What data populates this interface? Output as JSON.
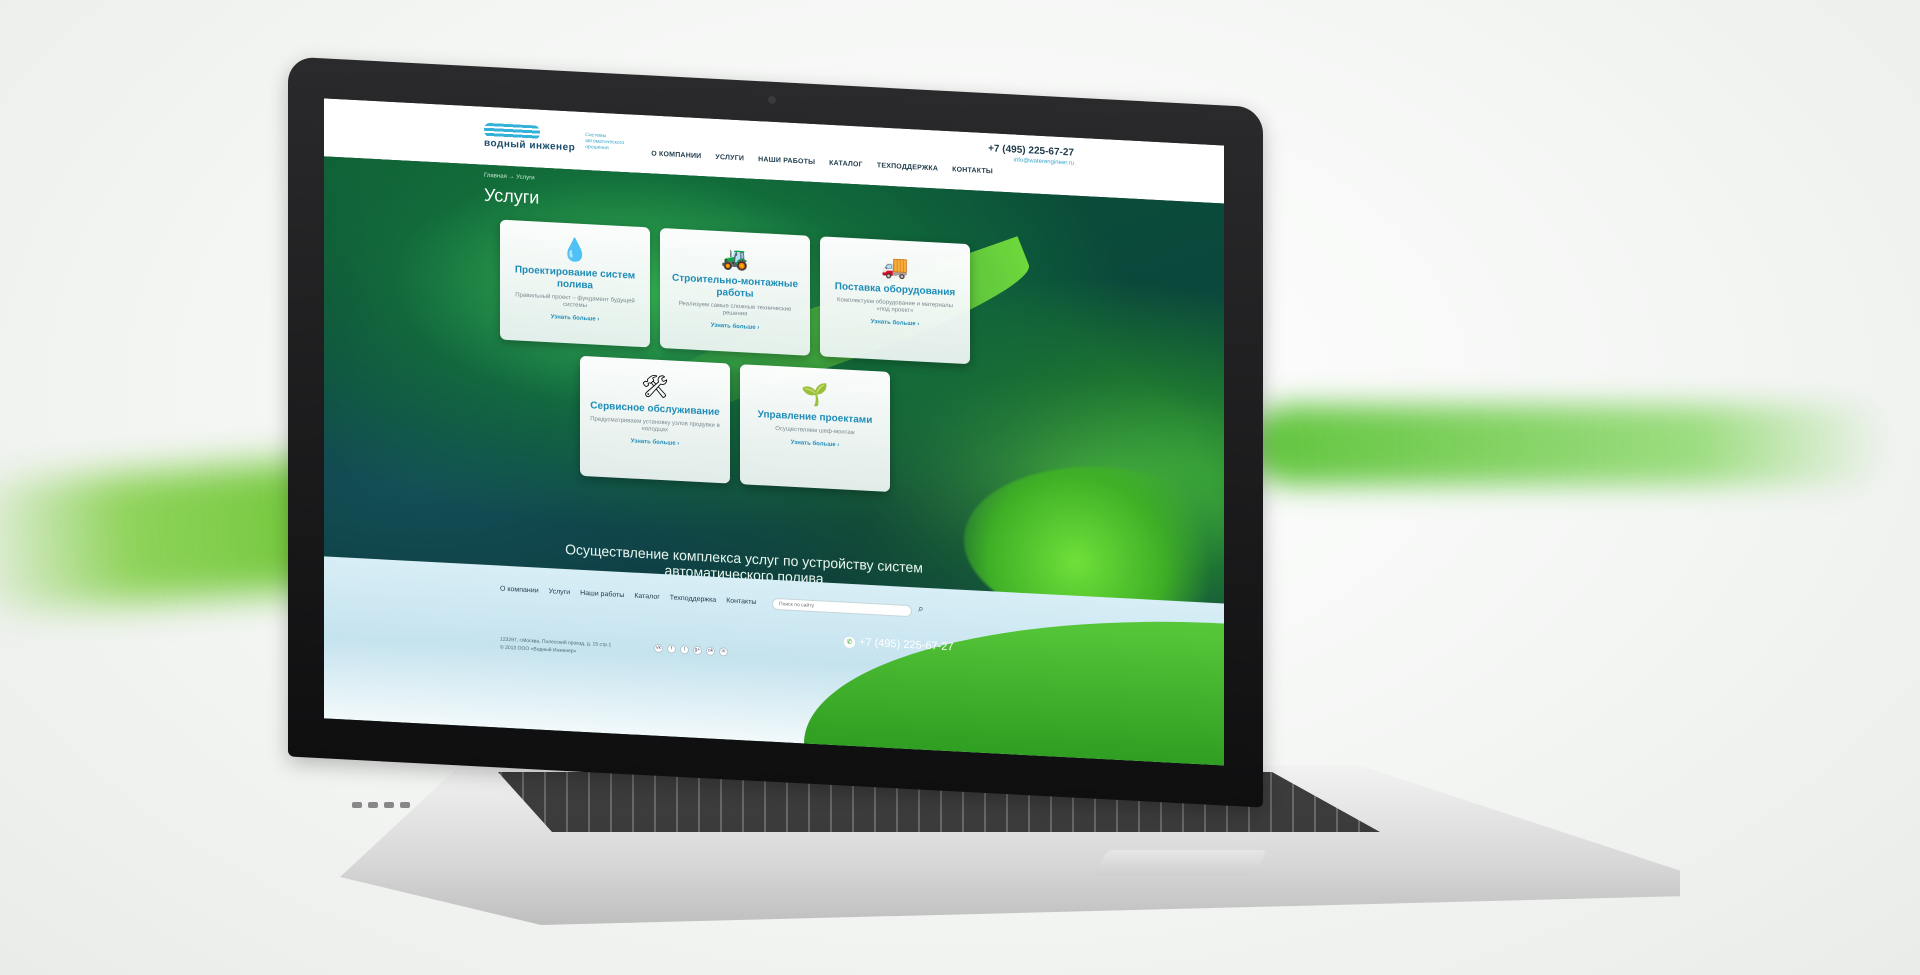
{
  "header": {
    "logo_name": "водный инженер",
    "logo_tagline": "Системы автоматического орошения",
    "phone": "+7 (495) 225-67-27",
    "email": "info@waterengineer.ru",
    "nav": [
      "О КОМПАНИИ",
      "УСЛУГИ",
      "НАШИ РАБОТЫ",
      "КАТАЛОГ",
      "ТЕХПОДДЕРЖКА",
      "КОНТАКТЫ"
    ]
  },
  "breadcrumb": "Главная → Услуги",
  "page_title": "Услуги",
  "cards": [
    {
      "icon": "water-drop-icon",
      "title": "Проектирование систем полива",
      "desc": "Правильный проект – фундамент будущей системы",
      "more": "Узнать больше ›"
    },
    {
      "icon": "excavator-icon",
      "title": "Строительно-монтажные работы",
      "desc": "Реализуем самые сложные технические решения",
      "more": "Узнать больше ›"
    },
    {
      "icon": "truck-icon",
      "title": "Поставка оборудования",
      "desc": "Комплектуем оборудование и материалы «под проект»",
      "more": "Узнать больше ›"
    },
    {
      "icon": "wrench-screwdriver-icon",
      "title": "Сервисное обслуживание",
      "desc": "Предусматриваем установку узлов продувки в колодцах",
      "more": "Узнать больше ›"
    },
    {
      "icon": "sprinkler-icon",
      "title": "Управление проектами",
      "desc": "Осуществляем шеф-монтаж",
      "more": "Узнать больше ›"
    }
  ],
  "tagline": "Осуществление комплекса услуг по устройству систем автоматического полива",
  "footer": {
    "nav": [
      "О компании",
      "Услуги",
      "Наши работы",
      "Каталог",
      "Техподдержка",
      "Контакты"
    ],
    "search_placeholder": "Поиск по сайту",
    "address": "123297, г.Москва, Полесский проезд, д. 15 стр.1",
    "copyright": "© 2013 ООО «Водный Инженер»",
    "phone": "+7 (495) 225-67-27",
    "socials": [
      "vk",
      "f",
      "t",
      "g+",
      "ok",
      "in"
    ]
  },
  "colors": {
    "accent": "#1f8db8",
    "brand_green": "#3fb026",
    "header_text": "#1e3a4a"
  }
}
